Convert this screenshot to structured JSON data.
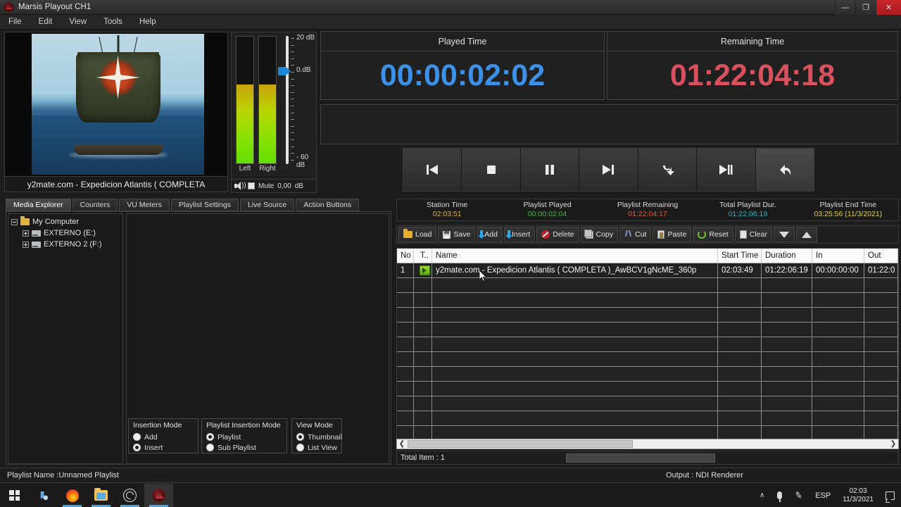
{
  "window": {
    "title": "Marsis Playout CH1",
    "logo_icon": "marsis-logo-icon",
    "minimize": "—",
    "maximize": "❐",
    "close": "✕"
  },
  "menu": {
    "items": [
      "File",
      "Edit",
      "View",
      "Tools",
      "Help"
    ]
  },
  "preview": {
    "clip_title": "y2mate.com - Expedicion Atlantis ( COMPLETA",
    "scene_description": "sailing ship with sun-star emblem on sail at sea"
  },
  "vu": {
    "left_label": "Left",
    "right_label": "Right",
    "left_level_pct": 62,
    "right_level_pct": 62,
    "scale_top": "20 dB",
    "scale_mid": "0.dB",
    "scale_bottom": "- 60 dB",
    "mute_label": "Mute",
    "gain_value": "0,00",
    "gain_unit": "dB",
    "speaker_icon": "speaker-icon"
  },
  "clocks": {
    "played": {
      "label": "Played Time",
      "value": "00:00:02:02",
      "color": "#3b90e8"
    },
    "remaining": {
      "label": "Remaining Time",
      "value": "01:22:04:18",
      "color": "#d9515e"
    }
  },
  "transport": {
    "buttons": [
      {
        "name": "skip-to-start-button",
        "icon": "skip-back-icon"
      },
      {
        "name": "stop-button",
        "icon": "stop-icon"
      },
      {
        "name": "pause-button",
        "icon": "pause-icon"
      },
      {
        "name": "next-button",
        "icon": "skip-forward-icon"
      },
      {
        "name": "loop-button",
        "icon": "loop-arrow-icon"
      },
      {
        "name": "play-next-button",
        "icon": "skip-forward-pause-icon"
      },
      {
        "name": "undo-button",
        "icon": "undo-arrow-icon"
      }
    ]
  },
  "left_tabs": {
    "items": [
      "Media Explorer",
      "Counters",
      "VU Meters",
      "Playlist Settings",
      "Live Source",
      "Action Buttons"
    ],
    "active_index": 0
  },
  "tree": {
    "root": {
      "label": "My Computer",
      "icon": "folder-icon",
      "expanded": true
    },
    "children": [
      {
        "label": "EXTERNO (E:)",
        "icon": "drive-icon",
        "expanded": false
      },
      {
        "label": "EXTERNO 2 (F:)",
        "icon": "drive-icon",
        "expanded": false
      }
    ]
  },
  "option_groups": [
    {
      "title": "Insertion Mode",
      "options": [
        {
          "label": "Add",
          "selected": false
        },
        {
          "label": "Insert",
          "selected": true
        }
      ]
    },
    {
      "title": "Playlist Insertion Mode",
      "options": [
        {
          "label": "Playlist",
          "selected": true
        },
        {
          "label": "Sub Playlist",
          "selected": false
        }
      ]
    },
    {
      "title": "View Mode",
      "options": [
        {
          "label": "Thumbnail",
          "selected": true
        },
        {
          "label": "List View",
          "selected": false
        }
      ]
    }
  ],
  "playlist_info": [
    {
      "key": "Station Time",
      "value": "02:03:51",
      "color": "#d9b23a"
    },
    {
      "key": "Playlist Played",
      "value": "00:00:02:04",
      "color": "#4caf50"
    },
    {
      "key": "Playlist Remaining",
      "value": "01:22:04:17",
      "color": "#d9603a"
    },
    {
      "key": "Total Playlist Dur.",
      "value": "01:22:06:19",
      "color": "#2fb6b0"
    },
    {
      "key": "Playlist End Time",
      "value": "03:25:56 (11/3/2021)",
      "color": "#d9d03a"
    }
  ],
  "playlist_toolbar": [
    {
      "label": "Load",
      "icon": "folder-open-icon"
    },
    {
      "label": "Save",
      "icon": "floppy-disk-icon"
    },
    {
      "label": "Add",
      "icon": "arrow-down-icon"
    },
    {
      "label": "Insert",
      "icon": "arrow-down-icon"
    },
    {
      "label": "Delete",
      "icon": "delete-circle-icon"
    },
    {
      "label": "Copy",
      "icon": "copy-pages-icon"
    },
    {
      "label": "Cut",
      "icon": "scissors-icon"
    },
    {
      "label": "Paste",
      "icon": "clipboard-icon"
    },
    {
      "label": "Reset",
      "icon": "refresh-circle-icon"
    },
    {
      "label": "Clear",
      "icon": "page-icon"
    },
    {
      "label": "",
      "icon": "triangle-down-icon"
    },
    {
      "label": "",
      "icon": "triangle-up-icon"
    }
  ],
  "playlist_table": {
    "columns": [
      "No",
      "T..",
      "Name",
      "Start Time",
      "Duration",
      "In",
      "Out"
    ],
    "rows": [
      {
        "no": "1",
        "type_icon": "play-green-icon",
        "name": "y2mate.com - Expedicion Atlantis ( COMPLETA )_AwBCV1gNcME_360p",
        "start_time": "02:03:49",
        "duration": "01:22:06:19",
        "in": "00:00:00:00",
        "out": "01:22:0"
      }
    ],
    "empty_row_count": 11
  },
  "total_bar": {
    "label": "Total Item : 1"
  },
  "status_bar": {
    "playlist_name": "Playlist Name :Unnamed Playlist",
    "output": "Output : NDI Renderer"
  },
  "taskbar": {
    "items": [
      {
        "name": "start-button",
        "icon": "windows-logo-icon"
      },
      {
        "name": "cortana-search-button",
        "icon": "cortana-icon"
      },
      {
        "name": "firefox-button",
        "icon": "firefox-icon"
      },
      {
        "name": "file-explorer-button",
        "icon": "folder-explorer-icon"
      },
      {
        "name": "obs-studio-button",
        "icon": "obs-icon"
      },
      {
        "name": "marsis-playout-button",
        "icon": "marsis-icon"
      }
    ],
    "tray": {
      "chevron": "∧",
      "language": "ESP",
      "time": "02:03",
      "date": "11/3/2021"
    }
  }
}
